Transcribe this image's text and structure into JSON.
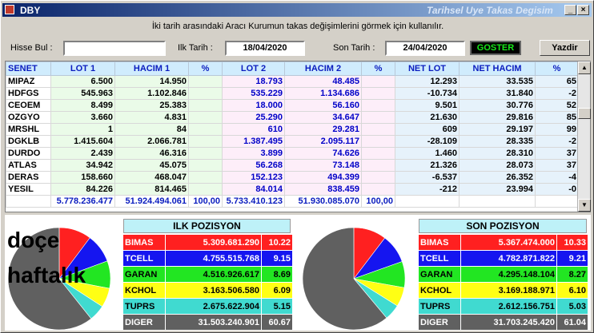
{
  "window": {
    "title": "DBY",
    "subtitle": "Tarihsel Uye Takas Degisim"
  },
  "info_text": "İki tarih arasındaki  Aracı Kurumun takas değişimlerini görmek için kullanılır.",
  "search": {
    "label": "Hisse Bul :",
    "value": ""
  },
  "dates": {
    "start_label": "Ilk Tarih :",
    "start_value": "18/04/2020",
    "end_label": "Son Tarih :",
    "end_value": "24/04/2020"
  },
  "buttons": {
    "goster": "GOSTER",
    "yazdir": "Yazdir"
  },
  "table": {
    "headers": [
      "SENET",
      "LOT 1",
      "HACIM 1",
      "%",
      "LOT 2",
      "HACIM 2",
      "%",
      "NET LOT",
      "NET HACIM",
      "%"
    ],
    "rows": [
      [
        "MIPAZ",
        "6.500",
        "14.950",
        "",
        "18.793",
        "48.485",
        "",
        "12.293",
        "33.535",
        "65"
      ],
      [
        "HDFGS",
        "545.963",
        "1.102.846",
        "",
        "535.229",
        "1.134.686",
        "",
        "-10.734",
        "31.840",
        "-2"
      ],
      [
        "CEOEM",
        "8.499",
        "25.383",
        "",
        "18.000",
        "56.160",
        "",
        "9.501",
        "30.776",
        "52"
      ],
      [
        "OZGYO",
        "3.660",
        "4.831",
        "",
        "25.290",
        "34.647",
        "",
        "21.630",
        "29.816",
        "85"
      ],
      [
        "MRSHL",
        "1",
        "84",
        "",
        "610",
        "29.281",
        "",
        "609",
        "29.197",
        "99"
      ],
      [
        "DGKLB",
        "1.415.604",
        "2.066.781",
        "",
        "1.387.495",
        "2.095.117",
        "",
        "-28.109",
        "28.335",
        "-2"
      ],
      [
        "DURDO",
        "2.439",
        "46.316",
        "",
        "3.899",
        "74.626",
        "",
        "1.460",
        "28.310",
        "37"
      ],
      [
        "ATLAS",
        "34.942",
        "45.075",
        "",
        "56.268",
        "73.148",
        "",
        "21.326",
        "28.073",
        "37"
      ],
      [
        "DERAS",
        "158.660",
        "468.047",
        "",
        "152.123",
        "494.399",
        "",
        "-6.537",
        "26.352",
        "-4"
      ],
      [
        "YESIL",
        "84.226",
        "814.465",
        "",
        "84.014",
        "838.459",
        "",
        "-212",
        "23.994",
        "-0"
      ]
    ],
    "totals": [
      "",
      "5.778.236.477",
      "51.924.494.061",
      "100,00",
      "5.733.410.123",
      "51.930.085.070",
      "100,00",
      "",
      "",
      ""
    ]
  },
  "watermark": {
    "line1": "doçe",
    "line2": "haftalık"
  },
  "ilk_pozisyon": {
    "title": "ILK POZISYON",
    "rows": [
      {
        "name": "BIMAS",
        "value": "5.309.681.290",
        "pct": "10.22",
        "bg": "#ff2020",
        "fg": "#ffffff"
      },
      {
        "name": "TCELL",
        "value": "4.755.515.768",
        "pct": "9.15",
        "bg": "#1515f0",
        "fg": "#ffffff"
      },
      {
        "name": "GARAN",
        "value": "4.516.926.617",
        "pct": "8.69",
        "bg": "#22e622",
        "fg": "#000000"
      },
      {
        "name": "KCHOL",
        "value": "3.163.506.580",
        "pct": "6.09",
        "bg": "#ffff14",
        "fg": "#000000"
      },
      {
        "name": "TUPRS",
        "value": "2.675.622.904",
        "pct": "5.15",
        "bg": "#40dad0",
        "fg": "#000000"
      },
      {
        "name": "DIGER",
        "value": "31.503.240.901",
        "pct": "60.67",
        "bg": "#606060",
        "fg": "#ffffff"
      }
    ]
  },
  "son_pozisyon": {
    "title": "SON POZISYON",
    "rows": [
      {
        "name": "BIMAS",
        "value": "5.367.474.000",
        "pct": "10.33",
        "bg": "#ff2020",
        "fg": "#ffffff"
      },
      {
        "name": "TCELL",
        "value": "4.782.871.822",
        "pct": "9.21",
        "bg": "#1515f0",
        "fg": "#ffffff"
      },
      {
        "name": "GARAN",
        "value": "4.295.148.104",
        "pct": "8.27",
        "bg": "#22e622",
        "fg": "#000000"
      },
      {
        "name": "KCHOL",
        "value": "3.169.188.971",
        "pct": "6.10",
        "bg": "#ffff14",
        "fg": "#000000"
      },
      {
        "name": "TUPRS",
        "value": "2.612.156.751",
        "pct": "5.03",
        "bg": "#40dad0",
        "fg": "#000000"
      },
      {
        "name": "DIGER",
        "value": "31.703.245.420",
        "pct": "61.04",
        "bg": "#606060",
        "fg": "#ffffff"
      }
    ]
  }
}
